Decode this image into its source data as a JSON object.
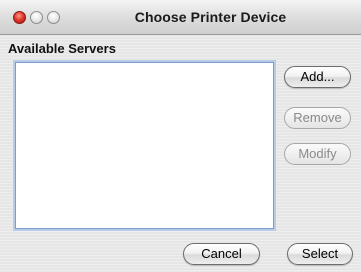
{
  "window": {
    "title": "Choose Printer Device"
  },
  "servers": {
    "label": "Available Servers",
    "items": []
  },
  "buttons": {
    "add": "Add...",
    "remove": "Remove",
    "modify": "Modify",
    "cancel": "Cancel",
    "select": "Select"
  },
  "colors": {
    "close_button": "#e0392f",
    "list_focus_ring": "#7a9ec9"
  }
}
